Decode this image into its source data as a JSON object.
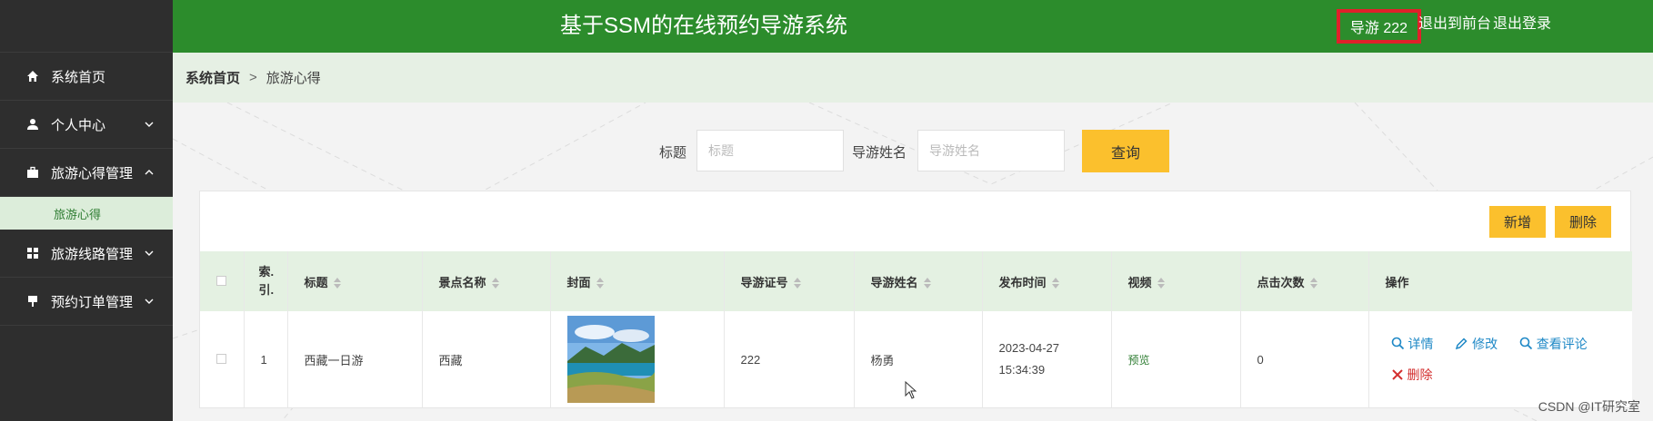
{
  "header": {
    "title": "基于SSM的在线预约导游系统",
    "user_label": "导游 222",
    "link_front": "退出到前台",
    "link_logout": "退出登录"
  },
  "sidebar": {
    "items": [
      {
        "label": "系统首页",
        "icon": "home-icon"
      },
      {
        "label": "个人中心",
        "icon": "user-icon"
      },
      {
        "label": "旅游心得管理",
        "icon": "briefcase-icon"
      },
      {
        "label": "旅游线路管理",
        "icon": "grid-icon"
      },
      {
        "label": "预约订单管理",
        "icon": "pin-icon"
      }
    ],
    "submenu_label": "旅游心得"
  },
  "breadcrumb": {
    "home": "系统首页",
    "separator": ">",
    "current": "旅游心得"
  },
  "search": {
    "title_label": "标题",
    "title_placeholder": "标题",
    "guide_label": "导游姓名",
    "guide_placeholder": "导游姓名",
    "query_button": "查询"
  },
  "toolbar": {
    "add_button": "新增",
    "delete_button": "删除"
  },
  "table": {
    "columns": [
      "索.\n引.",
      "标题",
      "景点名称",
      "封面",
      "导游证号",
      "导游姓名",
      "发布时间",
      "视频",
      "点击次数",
      "操作"
    ],
    "rows": [
      {
        "index": "1",
        "title": "西藏一日游",
        "scenic": "西藏",
        "guide_no": "222",
        "guide_name": "杨勇",
        "publish_time": "2023-04-27 15:34:39",
        "video": "预览",
        "clicks": "0",
        "ops": {
          "detail": "详情",
          "edit": "修改",
          "comments": "查看评论",
          "delete": "删除"
        }
      }
    ]
  },
  "watermark": "CSDN @IT研究室",
  "colors": {
    "header_green": "#2c8c2c",
    "sidebar_dark": "#2e2e2e",
    "button_yellow": "#fbc02d",
    "highlight_red": "#e0202a",
    "link_blue": "#1e88c6"
  }
}
